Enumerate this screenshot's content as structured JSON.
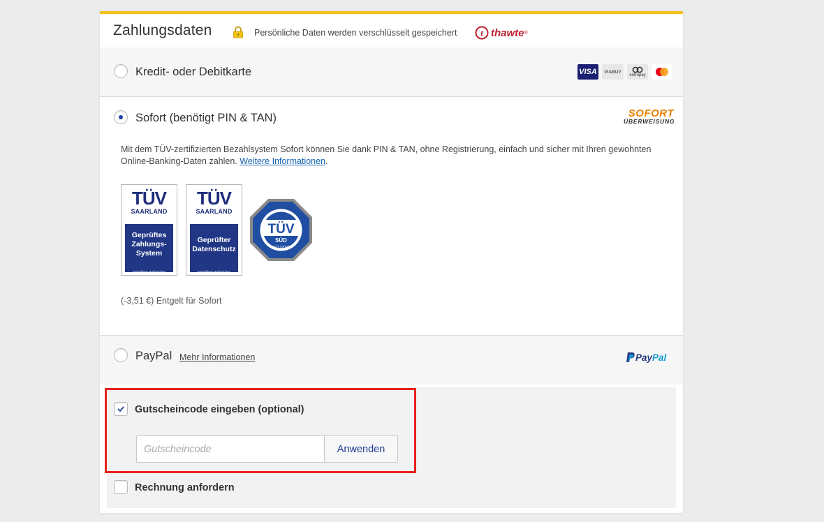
{
  "header": {
    "title": "Zahlungsdaten",
    "secure_text": "Persönliche Daten werden verschlüsselt gespeichert",
    "thawte_brand": "thawte",
    "thawte_tm": "®"
  },
  "payment_options": {
    "card": {
      "label": "Kredit- oder Debitkarte",
      "selected": false,
      "logos": {
        "visa": "VISA",
        "viabuy": "VIABUY",
        "entropay": "entropay",
        "mastercard": "mastercard"
      }
    },
    "sofort": {
      "label": "Sofort (benötigt PIN & TAN)",
      "selected": true,
      "logo_main": "SOFORT",
      "logo_sub": "ÜBERWEISUNG",
      "description": "Mit dem TÜV-zertifizierten Bezahlsystem Sofort können Sie dank PIN & TAN, ohne Registrierung, einfach und sicher mit Ihren gewohnten Online-Banking-Daten zahlen.",
      "more_link": "Weitere Informationen",
      "badges": [
        {
          "brand": "TÜV",
          "region": "SAARLAND",
          "line1": "Geprüftes",
          "line2": "Zahlungs-",
          "line3": "System",
          "footnote": "Freiwilliges Prüfzeichen"
        },
        {
          "brand": "TÜV",
          "region": "SAARLAND",
          "line1": "Geprüfter",
          "line2": "Datenschutz",
          "line3": "",
          "footnote": "Freiwilliges Prüfzeichen"
        }
      ],
      "tuv_sud": {
        "brand": "TÜV",
        "sub": "SÜD",
        "iso": "ISO 27001"
      },
      "fee": "(-3,51 €) Entgelt für Sofort"
    },
    "paypal": {
      "label": "PayPal",
      "selected": false,
      "more_link": "Mehr Informationen",
      "logo_pay": "Pay",
      "logo_pal": "Pal"
    }
  },
  "extras": {
    "voucher": {
      "checked": true,
      "label": "Gutscheincode eingeben (optional)",
      "placeholder": "Gutscheincode",
      "value": "",
      "apply_label": "Anwenden"
    },
    "invoice": {
      "checked": false,
      "label": "Rechnung anfordern"
    }
  },
  "colors": {
    "accent_bar": "#f2c21b",
    "radio_selected": "#1b3fa6",
    "link": "#1764b0",
    "highlight_box": "#e8221b"
  },
  "icons": {
    "lock": "lock-icon",
    "checkmark": "checkmark-icon",
    "paypal": "paypal-p-icon"
  }
}
